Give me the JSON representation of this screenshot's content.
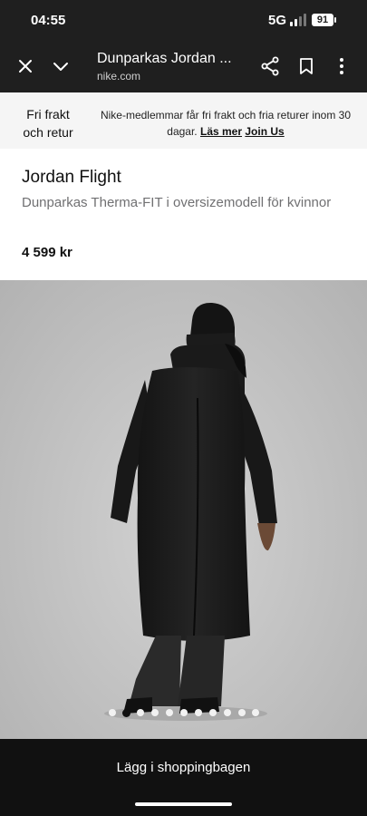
{
  "status_bar": {
    "time": "04:55",
    "network": "5G",
    "battery": "91"
  },
  "browser": {
    "title": "Dunparkas Jordan ...",
    "domain": "nike.com"
  },
  "banner": {
    "left_text": "Fri frakt och retur",
    "message": "Nike-medlemmar får fri frakt och fria returer inom 30 dagar.",
    "learn_more": "Läs mer",
    "join": "Join Us"
  },
  "product": {
    "name": "Jordan Flight",
    "subtitle": "Dunparkas Therma-FIT i oversizemodell för kvinnor",
    "price": "4 599 kr"
  },
  "carousel": {
    "total": 11,
    "active_index": 1
  },
  "cta": {
    "label": "Lägg i shoppingbagen"
  }
}
